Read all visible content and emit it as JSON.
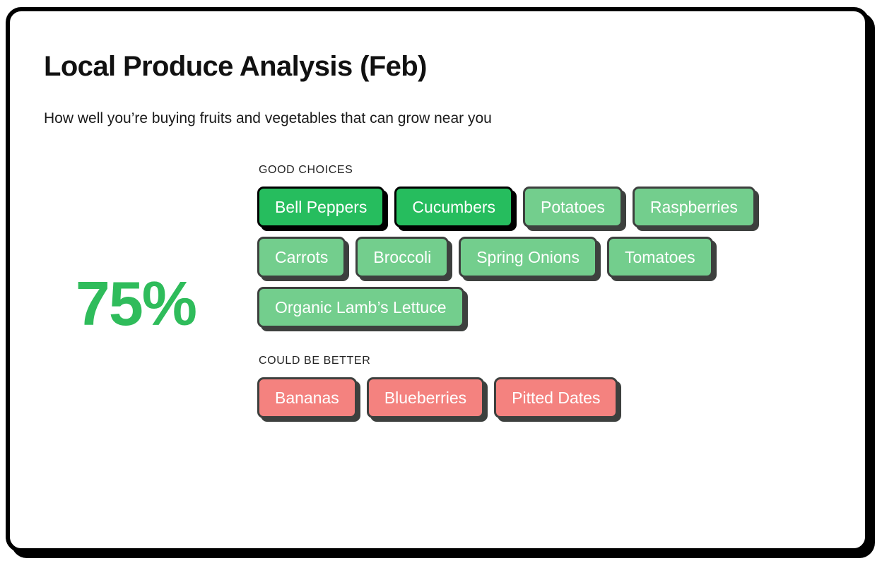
{
  "header": {
    "title": "Local Produce Analysis (Feb)",
    "subtitle": "How well you’re buying fruits and vegetables that can grow near you"
  },
  "score": {
    "value": "75%",
    "color": "#2FBC5B"
  },
  "colors": {
    "card_border": "#000000",
    "strong_chip_bg": "#26BD5E",
    "strong_chip_border": "#000000",
    "good_chip_bg": "#73CE8D",
    "good_chip_border": "#3D403E",
    "bad_chip_bg": "#F4827F",
    "bad_chip_border": "#3D403E",
    "chip_text": "#FFFFFF"
  },
  "sections": [
    {
      "label": "GOOD CHOICES",
      "rows": [
        [
          {
            "label": "Bell Peppers",
            "style": "strong"
          },
          {
            "label": "Cucumbers",
            "style": "strong"
          },
          {
            "label": "Potatoes",
            "style": "good"
          },
          {
            "label": "Raspberries",
            "style": "good"
          }
        ],
        [
          {
            "label": "Carrots",
            "style": "good"
          },
          {
            "label": "Broccoli",
            "style": "good"
          },
          {
            "label": "Spring Onions",
            "style": "good"
          },
          {
            "label": "Tomatoes",
            "style": "good"
          }
        ],
        [
          {
            "label": "Organic Lamb’s Lettuce",
            "style": "good"
          }
        ]
      ]
    },
    {
      "label": "COULD BE BETTER",
      "rows": [
        [
          {
            "label": "Bananas",
            "style": "bad"
          },
          {
            "label": "Blueberries",
            "style": "bad"
          },
          {
            "label": "Pitted Dates",
            "style": "bad"
          }
        ]
      ]
    }
  ]
}
